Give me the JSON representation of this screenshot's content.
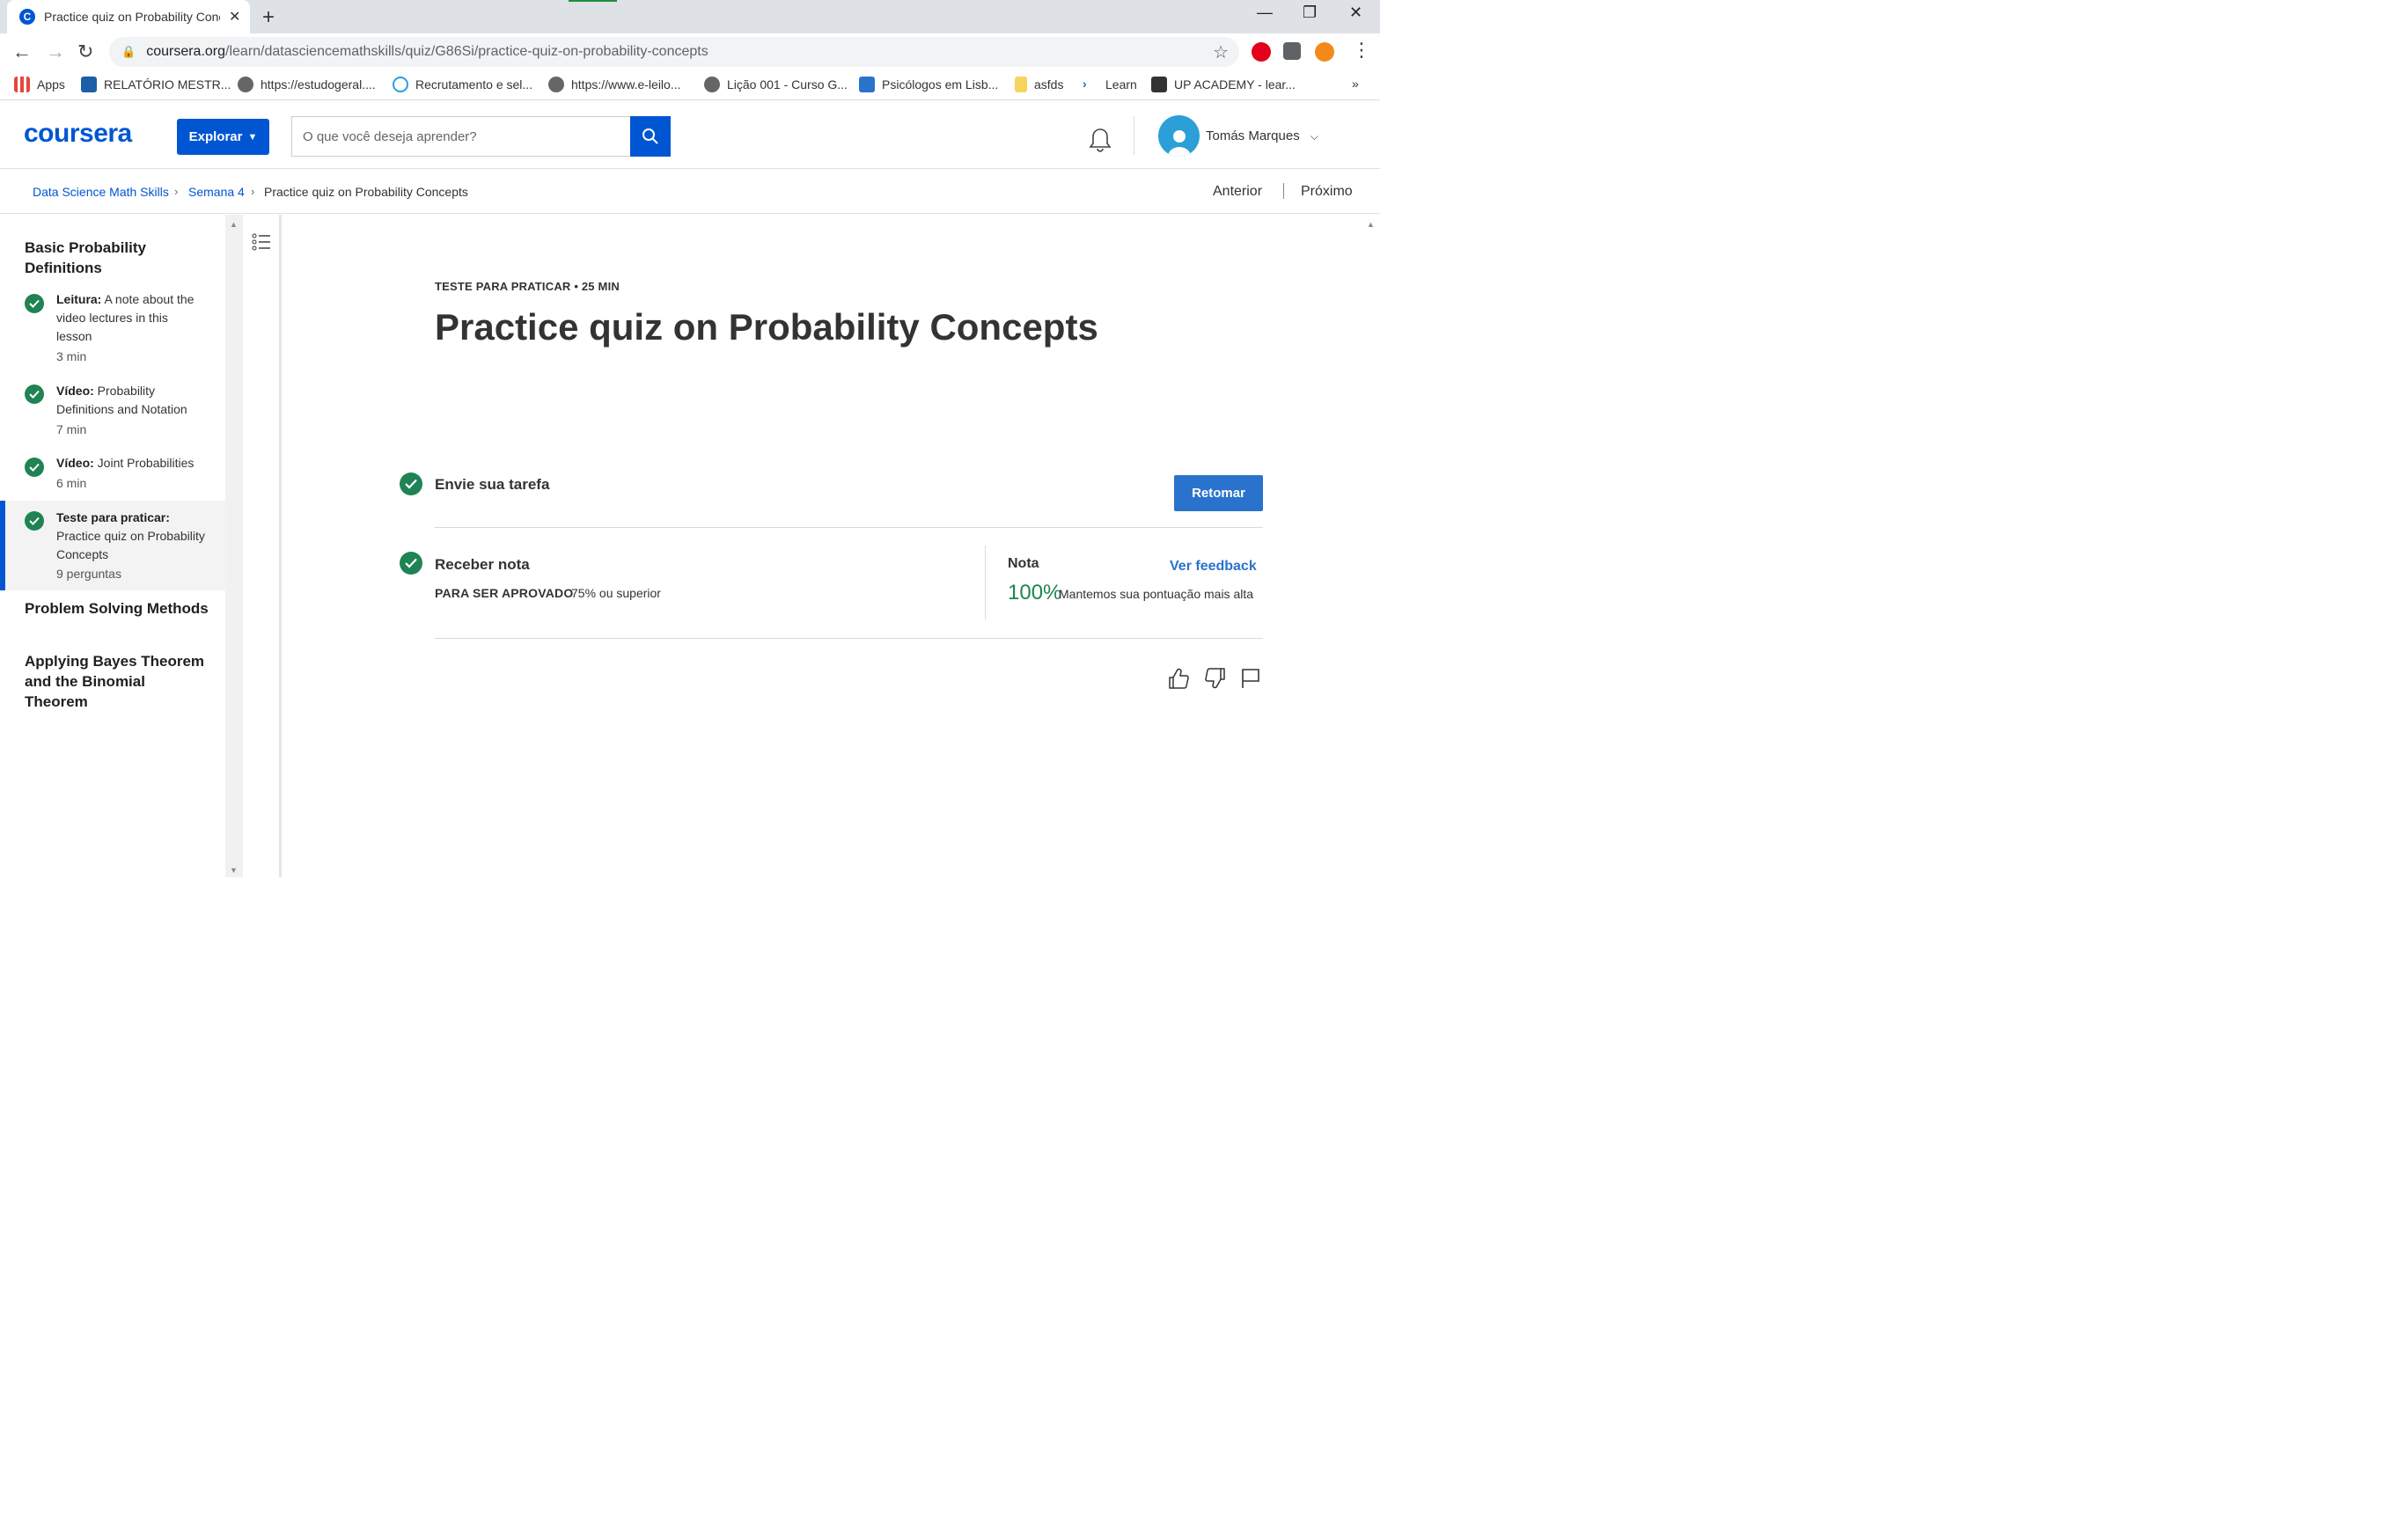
{
  "browser": {
    "tab_title": "Practice quiz on Probability Conc",
    "tab_favicon_letter": "C",
    "url_host": "coursera.org",
    "url_path": "/learn/datasciencemathskills/quiz/G86Si/practice-quiz-on-probability-concepts",
    "bookmarks": [
      {
        "label": "Apps",
        "icon": "apps-grid-icon",
        "color": "#e8453c"
      },
      {
        "label": "RELATÓRIO MESTR...",
        "icon": "bookmark-favicon",
        "color": "#1a5fa8"
      },
      {
        "label": "https://estudogeral....",
        "icon": "globe-icon",
        "color": "#555555"
      },
      {
        "label": "Recrutamento e sel...",
        "icon": "tg-icon",
        "color": "#2a9fd8"
      },
      {
        "label": "https://www.e-leilo...",
        "icon": "globe-icon",
        "color": "#555555"
      },
      {
        "label": "Lição 001 - Curso G...",
        "icon": "globe-icon",
        "color": "#555555"
      },
      {
        "label": "Psicólogos em Lisb...",
        "icon": "w-icon",
        "color": "#2a73cc"
      },
      {
        "label": "asfds",
        "icon": "folder-icon",
        "color": "#f6d55c"
      },
      {
        "label": "Learn",
        "icon": "learn-icon",
        "color": "#0078d4"
      },
      {
        "label": "UP ACADEMY - lear...",
        "icon": "terminal-icon",
        "color": "#333333"
      }
    ],
    "more_bookmarks": "»"
  },
  "header": {
    "logo": "coursera",
    "explore_label": "Explorar",
    "search_placeholder": "O que você deseja aprender?",
    "user_name": "Tomás Marques"
  },
  "breadcrumb": {
    "items": [
      "Data Science Math Skills",
      "Semana 4",
      "Practice quiz on Probability Concepts"
    ],
    "prev": "Anterior",
    "next": "Próximo"
  },
  "sidebar": {
    "sections": [
      {
        "title": "Basic Probability Definitions"
      },
      {
        "title": "Problem Solving Methods"
      },
      {
        "title": "Applying Bayes Theorem and the Binomial Theorem"
      }
    ],
    "items": [
      {
        "kind": "Leitura:",
        "name": "A note about the video lectures in this lesson",
        "meta": "3 min",
        "completed": true
      },
      {
        "kind": "Vídeo:",
        "name": "Probability Definitions and Notation",
        "meta": "7 min",
        "completed": true
      },
      {
        "kind": "Vídeo:",
        "name": "Joint Probabilities",
        "meta": "6 min",
        "completed": true
      },
      {
        "kind": "Teste para praticar:",
        "name": "Practice quiz on Probability Concepts",
        "meta": "9 perguntas",
        "completed": true,
        "active": true
      }
    ]
  },
  "main": {
    "eyebrow": "TESTE PARA PRATICAR • 25 MIN",
    "title": "Practice quiz on Probability Concepts",
    "step1": "Envie sua tarefa",
    "resume_label": "Retomar",
    "step2": "Receber nota",
    "pass_label": "PARA SER APROVADO",
    "pass_value": "75% ou superior",
    "grade_label": "Nota",
    "feedback_label": "Ver feedback",
    "grade_value": "100%",
    "grade_note": "Mantemos sua pontuação mais alta"
  },
  "colors": {
    "brand": "#0056d2",
    "success": "#1f8354",
    "button": "#2a73cc"
  }
}
